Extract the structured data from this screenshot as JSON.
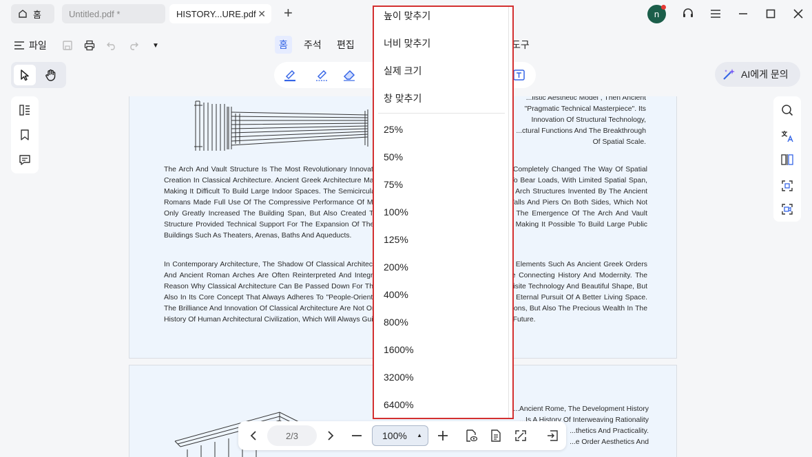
{
  "tabs": {
    "home_label": "홈",
    "untitled_label": "Untitled.pdf *",
    "history_label": "HISTORY...URE.pdf"
  },
  "account": {
    "avatar_letter": "n"
  },
  "menu": {
    "file_label": "파일",
    "tabs": [
      "홈",
      "주석",
      "편집",
      "도구"
    ]
  },
  "ai": {
    "label": "AI에게 문의"
  },
  "document": {
    "caption_lines": [
      "...listic Aesthetic Model , Then Ancient",
      "\"Pragmatic Technical Masterpiece\". Its",
      "Innovation Of Structural Technology,",
      "...ctural Functions And The Breakthrough",
      "Of Spatial Scale."
    ],
    "para1": "The Arch And Vault Structure Is The Most Revolutionary Innovation Of Ancient Roman Architecture, Which Completely Changed The Way Of Spatial Creation In Classical Architecture. Ancient Greek Architecture Mainly Adopted The Beam-Column Structure To Bear Loads, With Limited Spatial Span, Making It Difficult To Build Large Indoor Spaces. The Semicircular Arch, Barrel Vault, Groin Vault And Other Arch Structures Invented By The Ancient Romans Made Full Use Of The Compressive Performance Of Masonry To Evenly Transfer Loads To The Walls And Piers On Both Sides, Which Not Only Greatly Increased The Building Span, But Also Created Tall, Open And Transparent Indoor Spaces. The Emergence Of The Arch And Vault Structure Provided Technical Support For The Expansion Of The Functions Of Ancient Roman Architecture, Making It Possible To Build Large Public Buildings Such As Theaters, Arenas, Baths And Aqueducts.",
    "para2": "In Contemporary Architecture, The Shadow Of Classical Architecture Can Still Be Seen Everywhere. Classic Elements Such As Ancient Greek Orders And Ancient Roman Arches Are Often Reinterpreted And Integrated In A Modern Way, Becoming A Bridge Connecting History And Modernity. The Reason Why Classical Architecture Can Be Passed Down For Thousands Of Years Lies Not Only In Its Exquisite Technology And Beautiful Shape, But Also In Its Core Concept That Always Adheres To \"People-Oriented\", Which Are In Line With Human Beings' Eternal Pursuit Of A Better Living Space. The Brilliance And Innovation Of Classical Architecture Are Not Only The Glorious Marks Of The Two Civilizations, But Also The Precious Wealth In The History Of Human Architectural Civilization, Which Will Always Guide The Development Of Architecture In The Future.",
    "page2_lines": [
      "...Ancient Rome, The Development History",
      "...Is A History Of Interweaving Rationality",
      "...thetics And Practicality.",
      "...e Order Aesthetics And"
    ]
  },
  "nav": {
    "page_indicator": "2/3",
    "zoom_value": "100%"
  },
  "zoom_menu": {
    "fit_items": [
      "높이 맞추기",
      "너비 맞추기",
      "실제 크기",
      "창 맞추기"
    ],
    "levels": [
      "25%",
      "50%",
      "75%",
      "100%",
      "125%",
      "200%",
      "400%",
      "800%",
      "1600%",
      "3200%",
      "6400%"
    ]
  },
  "colors": {
    "accent": "#3565e6",
    "highlight_border": "#d32f2f",
    "avatar": "#1b5e4a",
    "page_bg": "#eef5fd"
  }
}
